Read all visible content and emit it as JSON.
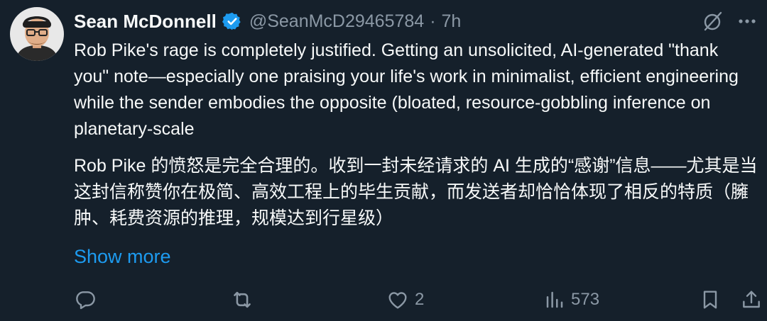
{
  "tweet": {
    "author_name": "Sean McDonnell",
    "handle": "@SeanMcD29465784",
    "separator": "·",
    "time": "7h",
    "text_en": "Rob Pike's rage is completely justified. Getting an unsolicited, AI-generated \"thank you\" note—especially one praising your life's work in minimalist, efficient engineering while the sender embodies the opposite (bloated, resource-gobbling inference on planetary-scale",
    "text_zh": "Rob Pike 的愤怒是完全合理的。收到一封未经请求的 AI 生成的“感谢”信息——尤其是当这封信称赞你在极简、高效工程上的毕生贡献，而发送者却恰恰体现了相反的特质（臃肿、耗费资源的推理，规模达到行星级）",
    "show_more": "Show more"
  },
  "actions": {
    "reply_count": "",
    "retweet_count": "",
    "like_count": "2",
    "views_count": "573"
  },
  "icons": {
    "verified": "verified-badge-icon",
    "grok": "grok-icon",
    "more": "more-icon",
    "reply": "reply-icon",
    "retweet": "retweet-icon",
    "like": "heart-icon",
    "views": "views-icon",
    "bookmark": "bookmark-icon",
    "share": "share-icon"
  },
  "colors": {
    "background": "#15202b",
    "text": "#f7f9f9",
    "secondary": "#8b98a5",
    "accent": "#1d9bf0"
  }
}
